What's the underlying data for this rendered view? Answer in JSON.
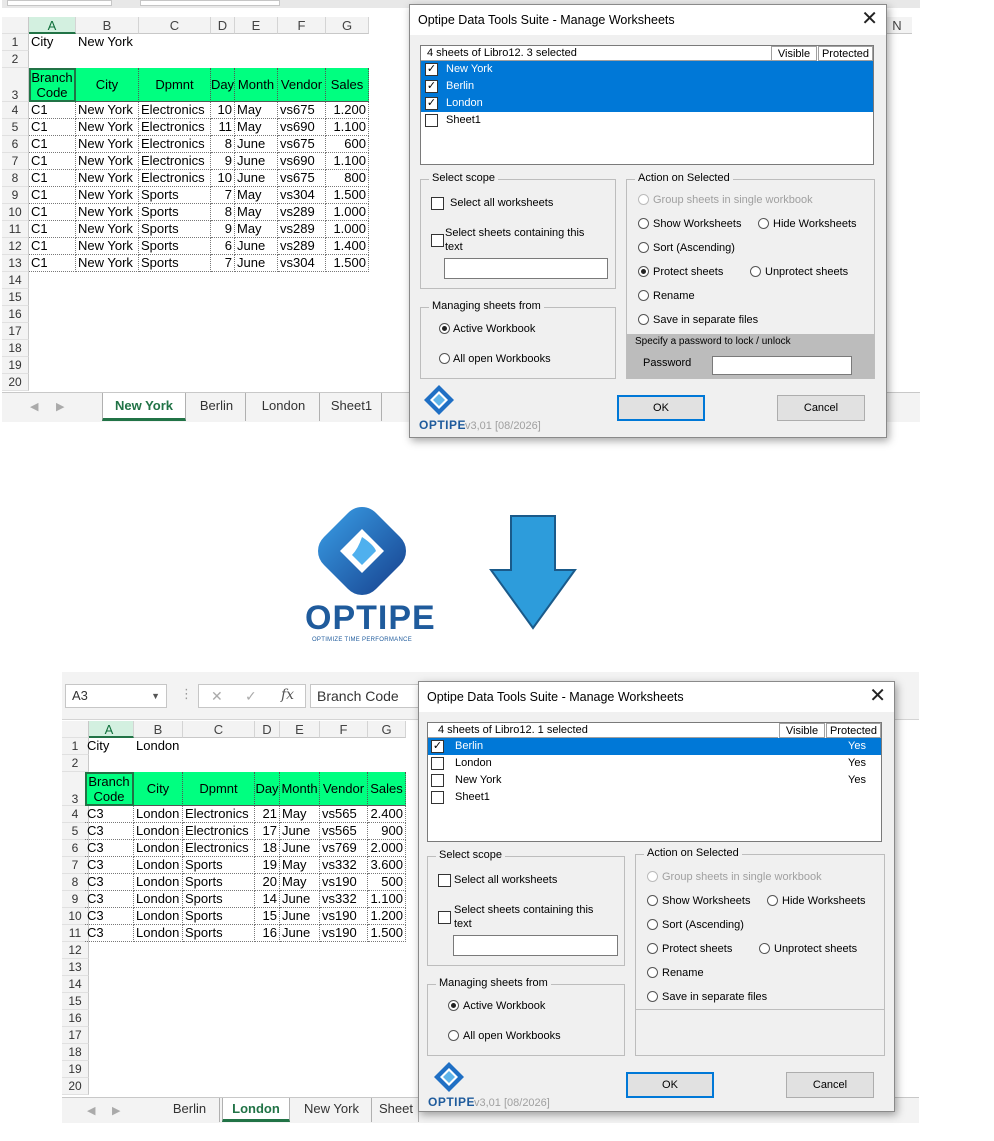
{
  "top": {
    "sheet": {
      "city_label": "City",
      "city_value": "New York",
      "columns": [
        "A",
        "B",
        "C",
        "D",
        "E",
        "F",
        "G"
      ],
      "extra_col": "N",
      "headers": [
        "Branch Code",
        "City",
        "Dpmnt",
        "Day",
        "Month",
        "Vendor",
        "Sales"
      ],
      "rows": [
        [
          "C1",
          "New York",
          "Electronics",
          "10",
          "May",
          "vs675",
          "1.200"
        ],
        [
          "C1",
          "New York",
          "Electronics",
          "11",
          "May",
          "vs690",
          "1.100"
        ],
        [
          "C1",
          "New York",
          "Electronics",
          "8",
          "June",
          "vs675",
          "600"
        ],
        [
          "C1",
          "New York",
          "Electronics",
          "9",
          "June",
          "vs690",
          "1.100"
        ],
        [
          "C1",
          "New York",
          "Electronics",
          "10",
          "June",
          "vs675",
          "800"
        ],
        [
          "C1",
          "New York",
          "Sports",
          "7",
          "May",
          "vs304",
          "1.500"
        ],
        [
          "C1",
          "New York",
          "Sports",
          "8",
          "May",
          "vs289",
          "1.000"
        ],
        [
          "C1",
          "New York",
          "Sports",
          "9",
          "May",
          "vs289",
          "1.000"
        ],
        [
          "C1",
          "New York",
          "Sports",
          "6",
          "June",
          "vs289",
          "1.400"
        ],
        [
          "C1",
          "New York",
          "Sports",
          "7",
          "June",
          "vs304",
          "1.500"
        ]
      ],
      "row_numbers": [
        "1",
        "2",
        "3",
        "4",
        "5",
        "6",
        "7",
        "8",
        "9",
        "10",
        "11",
        "12",
        "13",
        "14",
        "15",
        "16",
        "17",
        "18",
        "19",
        "20"
      ],
      "tabs": [
        "New York",
        "Berlin",
        "London",
        "Sheet1"
      ]
    },
    "dialog": {
      "title": "Optipe Data Tools Suite - Manage Worksheets",
      "list_header": "4 sheets of Libro12.  3 selected",
      "col_visible": "Visible",
      "col_protected": "Protected",
      "items": [
        {
          "name": "New York",
          "checked": true,
          "selected": true,
          "protected": ""
        },
        {
          "name": "Berlin",
          "checked": true,
          "selected": true,
          "protected": ""
        },
        {
          "name": "London",
          "checked": true,
          "selected": true,
          "protected": ""
        },
        {
          "name": "Sheet1",
          "checked": false,
          "selected": false,
          "protected": ""
        }
      ],
      "password_hint": "Specify a password to lock / unlock",
      "password_label": "Password",
      "version": "v3,01 [08/2026]"
    }
  },
  "common": {
    "select_scope": "Select scope",
    "select_all": "Select all worksheets",
    "select_containing_1": "Select sheets containing this",
    "select_containing_2": "text",
    "managing_from": "Managing sheets from",
    "active_workbook": "Active Workbook",
    "all_open": "All open Workbooks",
    "action_on_selected": "Action on Selected",
    "group_sheets": "Group sheets in single workbook",
    "show_ws": "Show Worksheets",
    "hide_ws": "Hide Worksheets",
    "sort_asc": "Sort (Ascending)",
    "protect": "Protect sheets",
    "unprotect": "Unprotect sheets",
    "rename": "Rename",
    "save_separate": "Save in separate files",
    "ok": "OK",
    "cancel": "Cancel",
    "brand": "OPTIPE",
    "logo_tagline": "OPTIMIZE TIME PERFORMANCE"
  },
  "bottom": {
    "name_box": "A3",
    "formula": "Branch Code",
    "sheet": {
      "city_label": "City",
      "city_value": "London",
      "columns": [
        "A",
        "B",
        "C",
        "D",
        "E",
        "F",
        "G"
      ],
      "headers": [
        "Branch Code",
        "City",
        "Dpmnt",
        "Day",
        "Month",
        "Vendor",
        "Sales"
      ],
      "rows": [
        [
          "C3",
          "London",
          "Electronics",
          "21",
          "May",
          "vs565",
          "2.400"
        ],
        [
          "C3",
          "London",
          "Electronics",
          "17",
          "June",
          "vs565",
          "900"
        ],
        [
          "C3",
          "London",
          "Electronics",
          "18",
          "June",
          "vs769",
          "2.000"
        ],
        [
          "C3",
          "London",
          "Sports",
          "19",
          "May",
          "vs332",
          "3.600"
        ],
        [
          "C3",
          "London",
          "Sports",
          "20",
          "May",
          "vs190",
          "500"
        ],
        [
          "C3",
          "London",
          "Sports",
          "14",
          "June",
          "vs332",
          "1.100"
        ],
        [
          "C3",
          "London",
          "Sports",
          "15",
          "June",
          "vs190",
          "1.200"
        ],
        [
          "C3",
          "London",
          "Sports",
          "16",
          "June",
          "vs190",
          "1.500"
        ]
      ],
      "row_numbers": [
        "1",
        "2",
        "3",
        "4",
        "5",
        "6",
        "7",
        "8",
        "9",
        "10",
        "11",
        "12",
        "13",
        "14",
        "15",
        "16",
        "17",
        "18",
        "19",
        "20"
      ],
      "tabs": [
        "Berlin",
        "London",
        "New York",
        "Sheet"
      ]
    },
    "dialog": {
      "title": "Optipe Data Tools Suite - Manage Worksheets",
      "list_header": "4 sheets of Libro12.  1 selected",
      "col_visible": "Visible",
      "col_protected": "Protected",
      "items": [
        {
          "name": "Berlin",
          "checked": true,
          "selected": true,
          "protected": "Yes"
        },
        {
          "name": "London",
          "checked": false,
          "selected": false,
          "protected": "Yes"
        },
        {
          "name": "New York",
          "checked": false,
          "selected": false,
          "protected": "Yes"
        },
        {
          "name": "Sheet1",
          "checked": false,
          "selected": false,
          "protected": ""
        }
      ],
      "version": "v3,01 [08/2026]"
    }
  },
  "colors": {
    "header_fill": "#00ff80",
    "selection": "#0078d7",
    "excel_green": "#217346",
    "logo_blue": "#1f5b9c",
    "arrow_blue": "#2d9cdb"
  }
}
